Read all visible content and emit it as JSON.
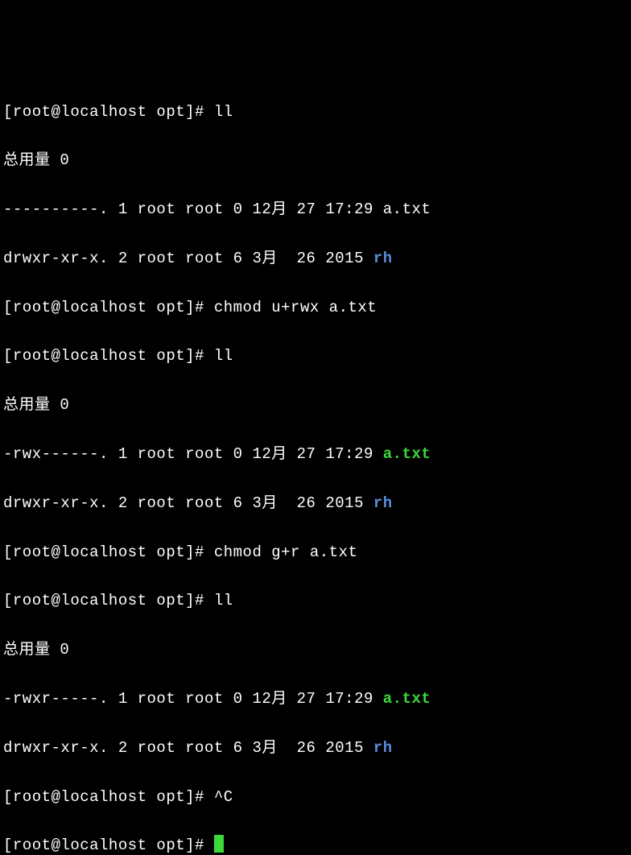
{
  "prompt": {
    "prefix": "[root@localhost opt]# "
  },
  "commands": {
    "ll1": "ll",
    "chmod1": "chmod u+rwx a.txt",
    "ll2": "ll",
    "chmod2": "chmod g+r a.txt",
    "ll3": "ll",
    "ctrlc": "^C",
    "empty": ""
  },
  "total_label": "总用量 0",
  "listings": {
    "l1": {
      "file_a": "----------. 1 root root 0 12月 27 17:29 a.txt",
      "dir_rh_pre": "drwxr-xr-x. 2 root root 6 3月  26 2015 ",
      "dir_rh_name": "rh"
    },
    "l2": {
      "file_a_pre": "-rwx------. 1 root root 0 12月 27 17:29 ",
      "file_a_name": "a.txt",
      "dir_rh_pre": "drwxr-xr-x. 2 root root 6 3月  26 2015 ",
      "dir_rh_name": "rh"
    },
    "l3": {
      "file_a_pre": "-rwxr-----. 1 root root 0 12月 27 17:29 ",
      "file_a_name": "a.txt",
      "dir_rh_pre": "drwxr-xr-x. 2 root root 6 3月  26 2015 ",
      "dir_rh_name": "rh"
    }
  }
}
